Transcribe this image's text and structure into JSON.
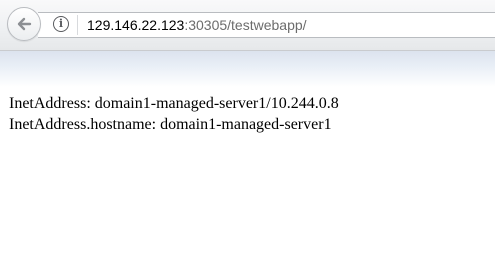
{
  "address_bar": {
    "host": "129.146.22.123",
    "path": ":30305/testwebapp/"
  },
  "page": {
    "lines": [
      "InetAddress: domain1-managed-server1/10.244.0.8",
      "InetAddress.hostname: domain1-managed-server1"
    ]
  },
  "icons": {
    "back": "back-arrow-icon",
    "site_info": "info-icon"
  }
}
